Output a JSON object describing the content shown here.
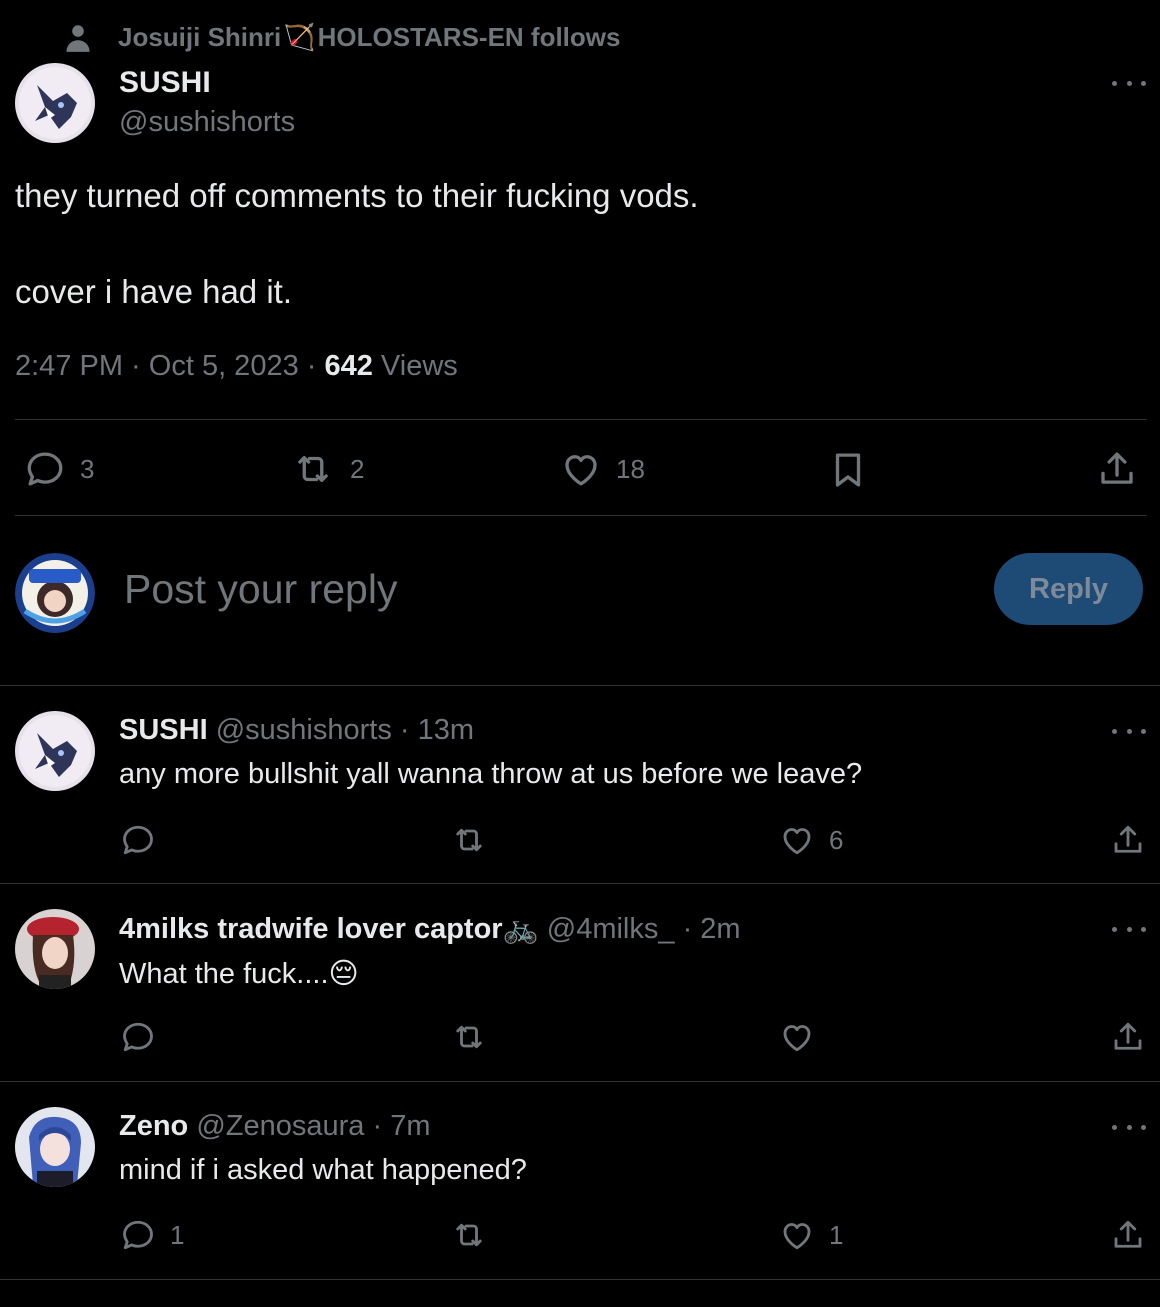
{
  "social_context": {
    "name": "Josuiji Shinri",
    "emoji": "🏹",
    "suffix": "HOLOSTARS-EN follows"
  },
  "tweet": {
    "author_name": "SUSHI",
    "author_handle": "@sushishorts",
    "text": "they turned off comments to their fucking vods.\n\ncover i have had it.",
    "time": "2:47 PM · Oct 5, 2023 · ",
    "views_count": "642",
    "views_label": " Views",
    "reply_count": "3",
    "retweet_count": "2",
    "like_count": "18"
  },
  "composer": {
    "placeholder": "Post your reply",
    "button_label": "Reply"
  },
  "replies": [
    {
      "name": "SUSHI",
      "handle": "@sushishorts",
      "time": " · 13m",
      "text": "any more bullshit yall wanna throw at us before we leave?",
      "reply_count": "",
      "like_count": "6"
    },
    {
      "name": "4milks tradwife lover captor",
      "name_emoji": "🚲",
      "handle": "@4milks_",
      "time": " · 2m",
      "text": "What the fuck....",
      "text_emoji": "😔",
      "reply_count": "",
      "like_count": ""
    },
    {
      "name": "Zeno",
      "handle": "@Zenosaura",
      "time": " · 7m",
      "text": "mind if i asked what happened?",
      "reply_count": "1",
      "like_count": "1"
    }
  ],
  "colors": {
    "background": "#000000",
    "text": "#e7e9ea",
    "muted": "#71767b",
    "border": "#2f3336",
    "reply_button": "#1e4a76"
  }
}
